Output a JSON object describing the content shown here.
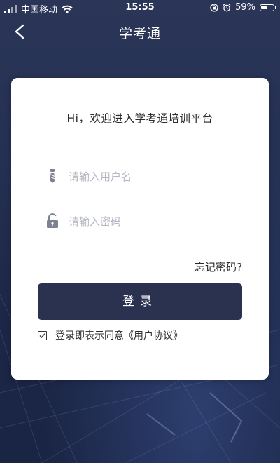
{
  "status_bar": {
    "carrier": "中国移动",
    "time": "15:55",
    "battery_percent": "59%",
    "battery_level": 0.59,
    "icons": [
      "signal-icon",
      "wifi-icon",
      "orientation-lock-icon",
      "alarm-icon",
      "battery-icon"
    ]
  },
  "nav": {
    "title": "学考通",
    "back_icon": "back-chevron-icon"
  },
  "login": {
    "welcome": "Hi，欢迎进入学考通培训平台",
    "username_placeholder": "请输入用户名",
    "username_value": "",
    "username_icon": "user-tie-icon",
    "password_placeholder": "请输入密码",
    "password_value": "",
    "password_icon": "unlock-icon",
    "forgot_password": "忘记密码?",
    "login_button": "登录",
    "agreement_checked": true,
    "agreement_text": "登录即表示同意",
    "agreement_link": "《用户协议》"
  },
  "colors": {
    "background": "#1f2a4a",
    "card": "#ffffff",
    "button": "#2b3250",
    "placeholder": "#b3b7c0"
  }
}
